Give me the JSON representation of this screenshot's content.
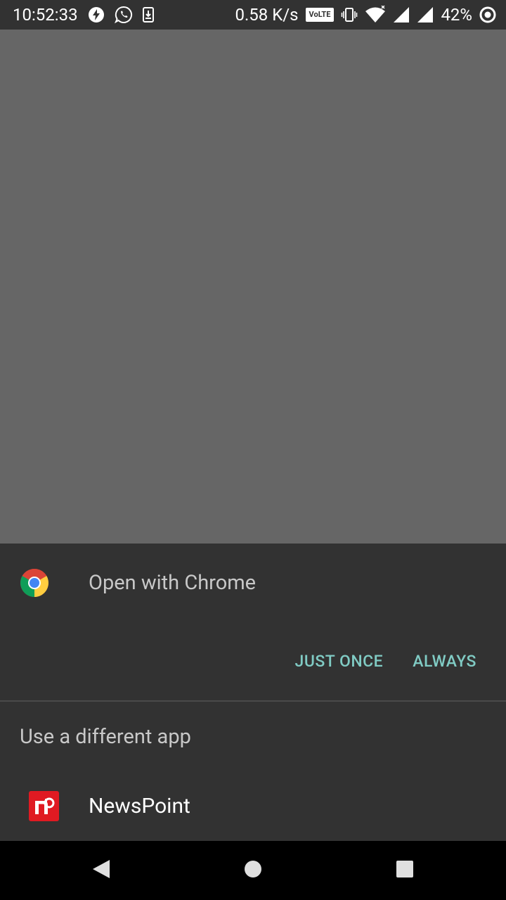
{
  "status_bar": {
    "time": "10:52:33",
    "network_speed": "0.58 K/s",
    "volte_label": "VoLTE",
    "battery_percent": "42%",
    "left_icons": [
      "flash-icon",
      "whatsapp-icon",
      "download-icon"
    ],
    "right_icons": [
      "vibrate-icon",
      "wifi-icon",
      "signal-icon",
      "signal-icon",
      "battery-saver-icon"
    ]
  },
  "chooser": {
    "title": "Open with Chrome",
    "app_icon": "chrome-icon",
    "buttons": {
      "just_once": "JUST ONCE",
      "always": "ALWAYS"
    },
    "section_label": "Use a different app",
    "apps": [
      {
        "label": "NewsPoint",
        "icon": "newspoint-icon"
      }
    ]
  },
  "navigation": {
    "buttons": [
      "back-icon",
      "home-icon",
      "recents-icon"
    ]
  },
  "colors": {
    "scrim": "#666666",
    "sheet": "#323232",
    "accent": "#80cbc4",
    "newspoint_red": "#e01a22"
  }
}
